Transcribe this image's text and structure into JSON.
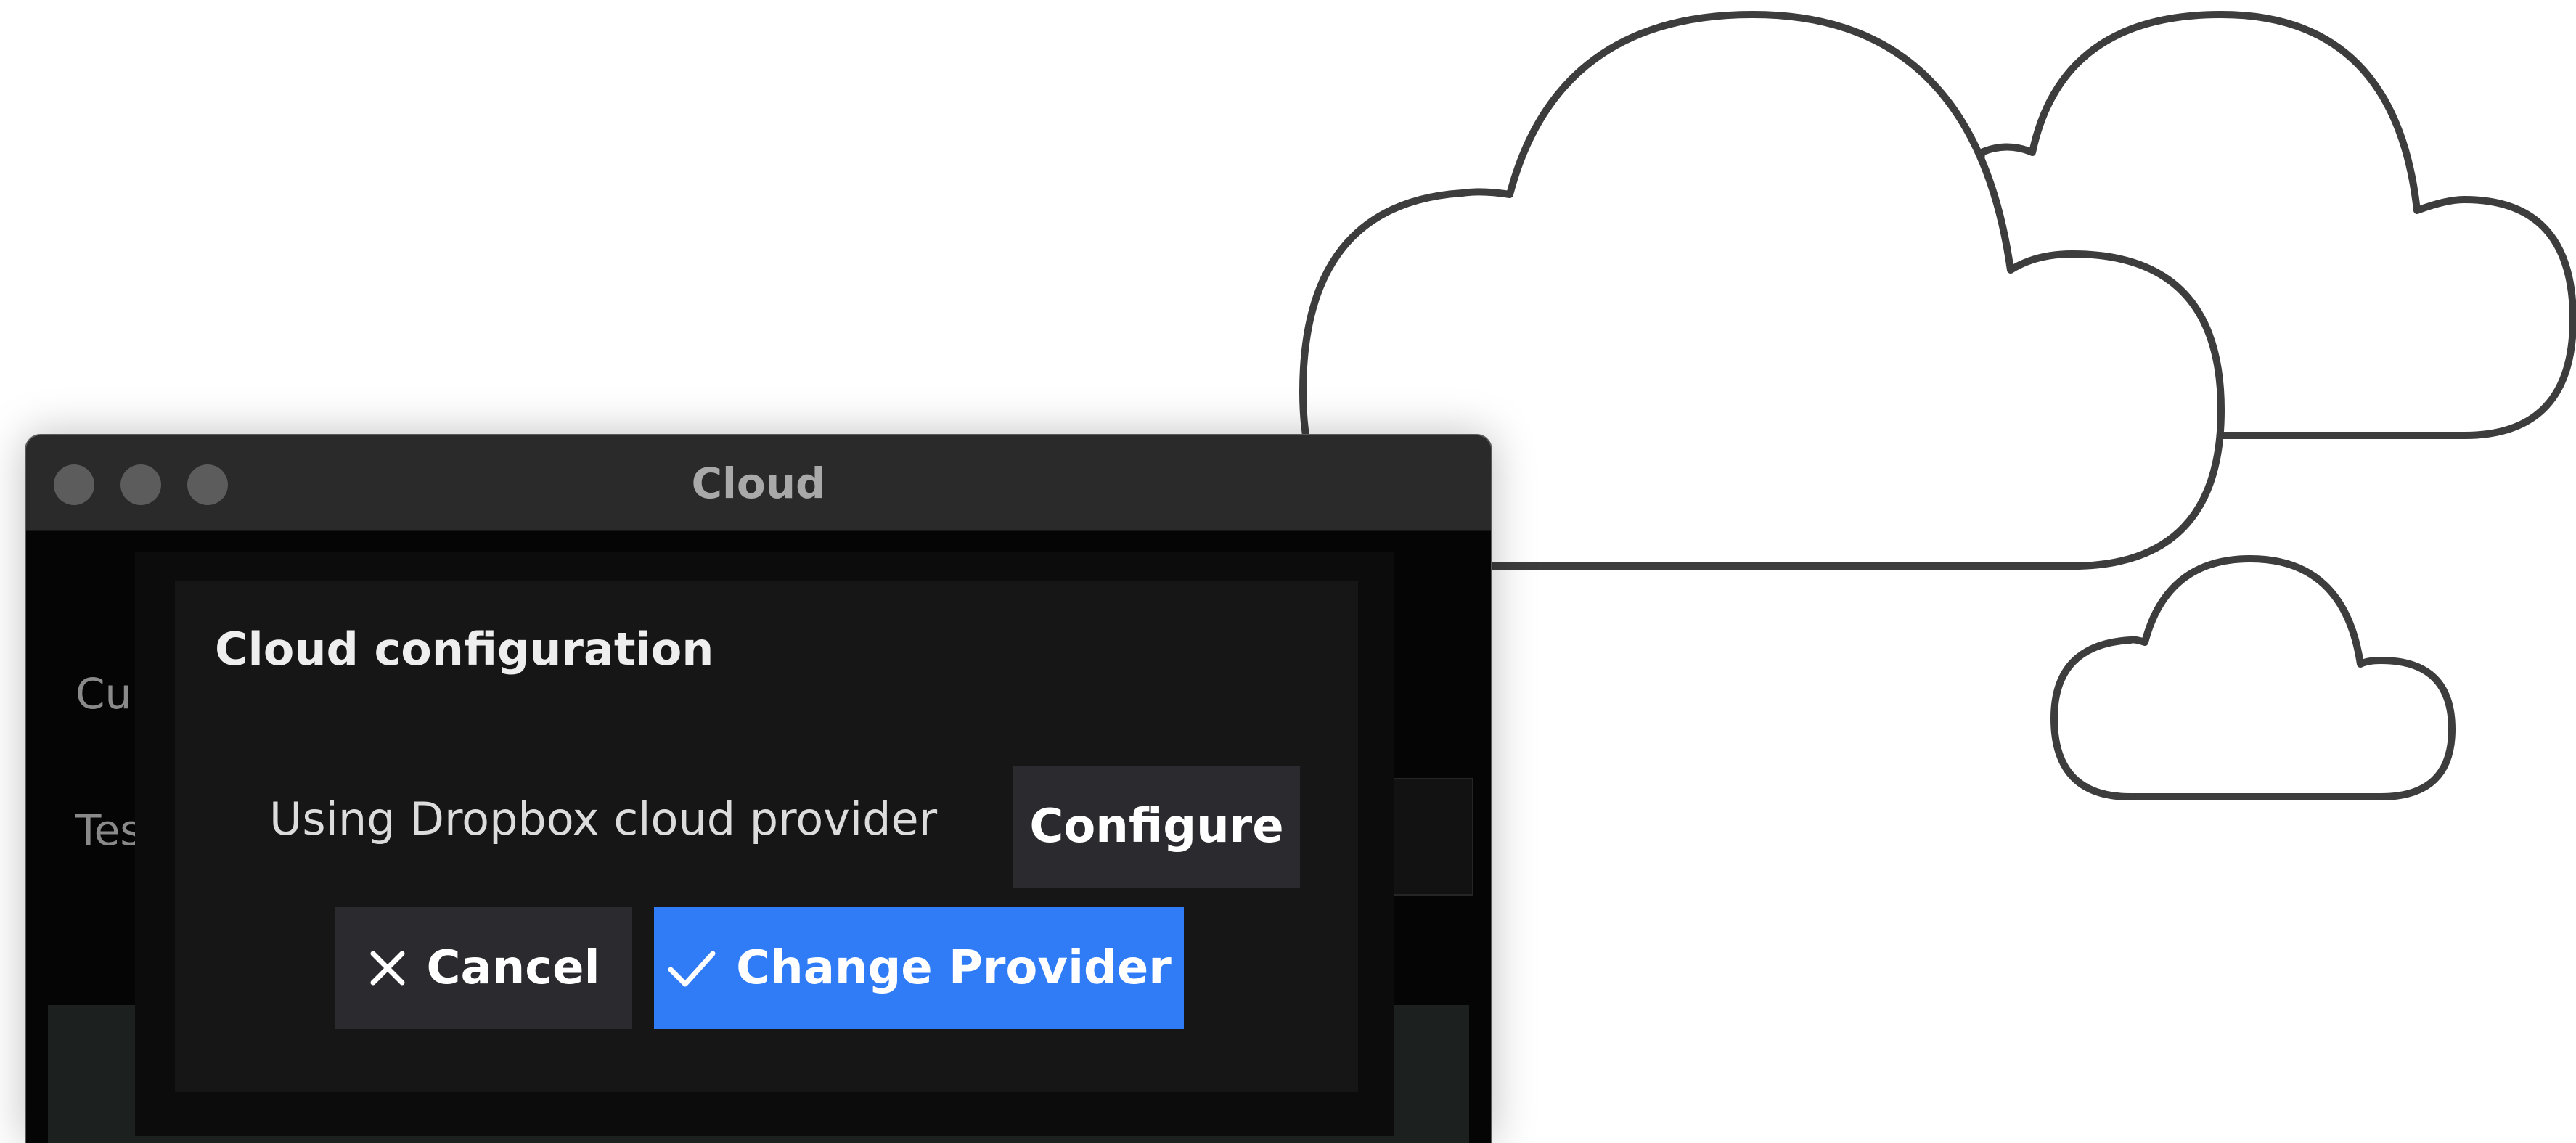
{
  "window": {
    "title": "Cloud",
    "background_labels": {
      "current": "Curr",
      "test": "Test"
    }
  },
  "dialog": {
    "title": "Cloud configuration",
    "provider_text": "Using Dropbox cloud provider",
    "configure_label": "Configure",
    "cancel_label": "Cancel",
    "change_provider_label": "Change Provider"
  },
  "icons": {
    "cancel": "close-icon",
    "change_provider": "checkmark-icon",
    "decoration": "cloud-icon"
  },
  "colors": {
    "accent": "#2f7cf6",
    "dialog_bg": "#161616",
    "window_bg": "#050505",
    "button_bg": "#2b2b2f"
  }
}
